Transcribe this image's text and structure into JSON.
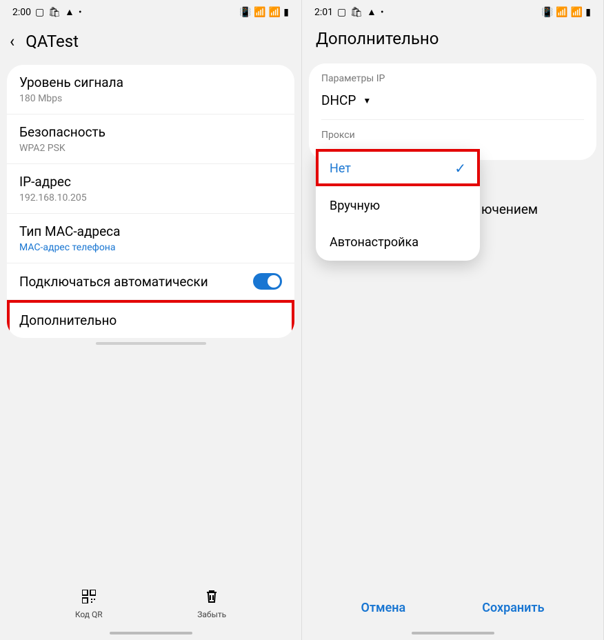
{
  "phone1": {
    "status": {
      "time": "2:00"
    },
    "header": {
      "title": "QATest"
    },
    "rows": {
      "signal": {
        "title": "Уровень сигнала",
        "sub": "180 Mbps"
      },
      "security": {
        "title": "Безопасность",
        "sub": "WPA2 PSK"
      },
      "ip": {
        "title": "IP-адрес",
        "sub": "192.168.10.205"
      },
      "mac": {
        "title": "Тип MAC-адреса",
        "sub": "MAC-адрес телефона"
      },
      "auto": {
        "title": "Подключаться автоматически"
      },
      "advanced": {
        "title": "Дополнительно"
      }
    },
    "bottom": {
      "qr": "Код QR",
      "forget": "Забыть"
    }
  },
  "phone2": {
    "status": {
      "time": "2:01"
    },
    "header": {
      "title": "Дополнительно"
    },
    "ip_params_label": "Параметры IP",
    "ip_params_value": "DHCP",
    "proxy_label": "Прокси",
    "proxy_options": {
      "none": "Нет",
      "manual": "Вручную",
      "auto": "Автонастройка"
    },
    "metered_tail": "ючением",
    "buttons": {
      "cancel": "Отмена",
      "save": "Сохранить"
    }
  }
}
